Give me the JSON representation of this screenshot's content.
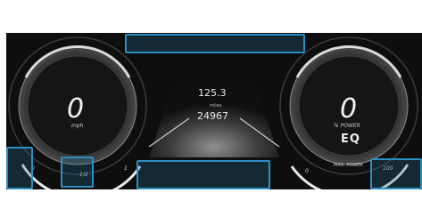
{
  "left_gauge": {
    "value": "0",
    "unit": "mph",
    "scale_min": "0",
    "scale_max": "1",
    "fuel_label": "1/2"
  },
  "center": {
    "distance": "125.3",
    "distance_unit": "miles",
    "odometer": "24967"
  },
  "right_gauge": {
    "value": "0",
    "unit": "% POWER",
    "brand": "EQ",
    "scale_min": "0",
    "scale_max": "100",
    "max_power_label": "MAX. POWER"
  },
  "colors": {
    "highlight": "#2a8fc4",
    "background": "#0e0e0e",
    "gauge_ring": "#d8d8d8"
  }
}
